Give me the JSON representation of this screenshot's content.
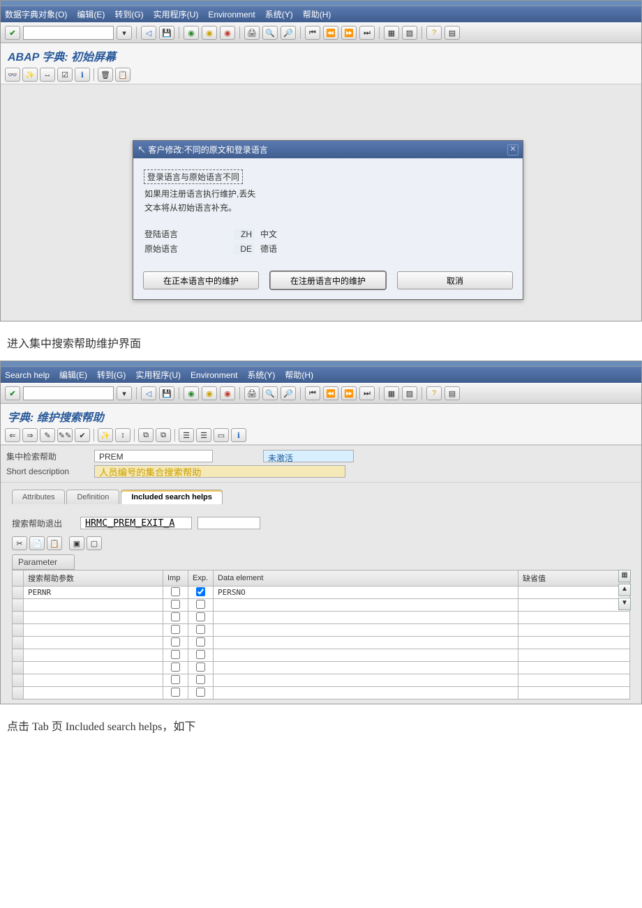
{
  "win1": {
    "menu": [
      "数据字典对象(O)",
      "编辑(E)",
      "转到(G)",
      "实用程序(U)",
      "Environment",
      "系统(Y)",
      "帮助(H)"
    ],
    "title": "ABAP 字典: 初始屏幕",
    "dialog": {
      "title": "客户修改:不同的原文和登录语言",
      "lines": [
        "登录语言与原始语言不同",
        "如果用注册语言执行维护,丢失",
        "文本将从初始语言补充。"
      ],
      "login_label": "登陆语言",
      "login_code": "ZH",
      "login_name": "中文",
      "orig_label": "原始语言",
      "orig_code": "DE",
      "orig_name": "德语",
      "btn_local": "在正本语言中的维护",
      "btn_reg": "在注册语言中的维护",
      "btn_cancel": "取消"
    }
  },
  "caption1": "进入集中搜索帮助维护界面",
  "win2": {
    "menu": [
      "Search help",
      "编辑(E)",
      "转到(G)",
      "实用程序(U)",
      "Environment",
      "系统(Y)",
      "帮助(H)"
    ],
    "title": "字典: 维护搜索帮助",
    "field_search_label": "集中检索帮助",
    "field_search_value": "PREM",
    "status": "未激活",
    "short_desc_label": "Short description",
    "short_desc_value": "人员编号的集合搜索帮助",
    "tabs": {
      "attr": "Attributes",
      "def": "Definition",
      "inc": "Included search helps"
    },
    "exit_label": "搜索帮助退出",
    "exit_value": "HRMC_PREM_EXIT_A",
    "param_label": "Parameter",
    "cols": {
      "p": "搜索帮助参数",
      "imp": "Imp",
      "exp": "Exp.",
      "de": "Data element",
      "def": "缺省值"
    },
    "row1": {
      "param": "PERNR",
      "exp": true,
      "de": "PERSNO"
    }
  },
  "caption2": "点击 Tab 页 Included search helps，如下"
}
